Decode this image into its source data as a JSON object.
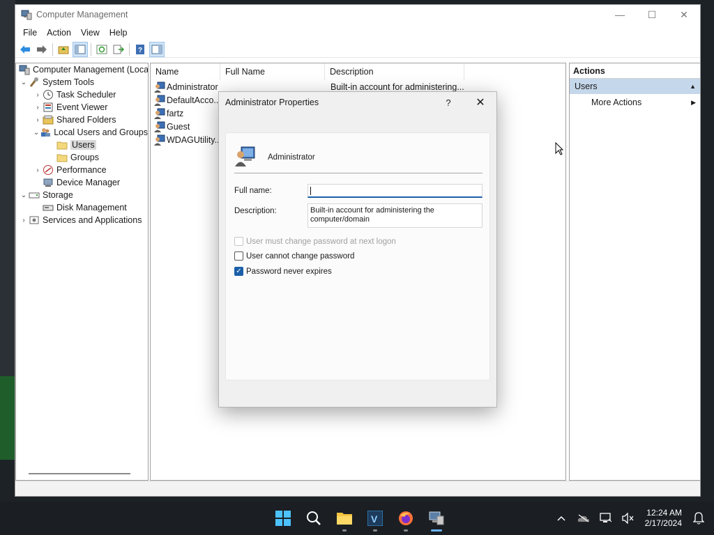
{
  "window": {
    "title": "Computer Management",
    "controls": {
      "minimize": "—",
      "maximize": "☐",
      "close": "✕"
    }
  },
  "menu": [
    "File",
    "Action",
    "View",
    "Help"
  ],
  "tree": {
    "root": "Computer Management (Local",
    "system_tools": "System Tools",
    "task_scheduler": "Task Scheduler",
    "event_viewer": "Event Viewer",
    "shared_folders": "Shared Folders",
    "local_users_groups": "Local Users and Groups",
    "users": "Users",
    "groups": "Groups",
    "performance": "Performance",
    "device_manager": "Device Manager",
    "storage": "Storage",
    "disk_management": "Disk Management",
    "services_apps": "Services and Applications"
  },
  "list": {
    "columns": [
      "Name",
      "Full Name",
      "Description"
    ],
    "rows": [
      {
        "name": "Administrator",
        "full_name": "",
        "description": "Built-in account for administering..."
      },
      {
        "name": "DefaultAcco...",
        "full_name": "",
        "description": ""
      },
      {
        "name": "fartz",
        "full_name": "",
        "description": ""
      },
      {
        "name": "Guest",
        "full_name": "",
        "description": ""
      },
      {
        "name": "WDAGUtility...",
        "full_name": "",
        "description": ""
      }
    ]
  },
  "actions": {
    "header": "Actions",
    "section": "Users",
    "more": "More Actions"
  },
  "dialog": {
    "title": "Administrator Properties",
    "help": "?",
    "close": "✕",
    "username": "Administrator",
    "full_name_label": "Full name:",
    "full_name_value": "",
    "description_label": "Description:",
    "description_value": "Built-in account for administering the computer/domain",
    "checkboxes": [
      {
        "label": "User must change password at next logon",
        "checked": false,
        "disabled": true
      },
      {
        "label": "User cannot change password",
        "checked": false,
        "disabled": false
      },
      {
        "label": "Password never expires",
        "checked": true,
        "disabled": false
      }
    ]
  },
  "taskbar": {
    "clock_time": "12:24 AM",
    "clock_date": "2/17/2024"
  },
  "colors": {
    "accent": "#1b5fa8",
    "selection": "#c5d7ea",
    "taskbar": "#1b1f24"
  }
}
